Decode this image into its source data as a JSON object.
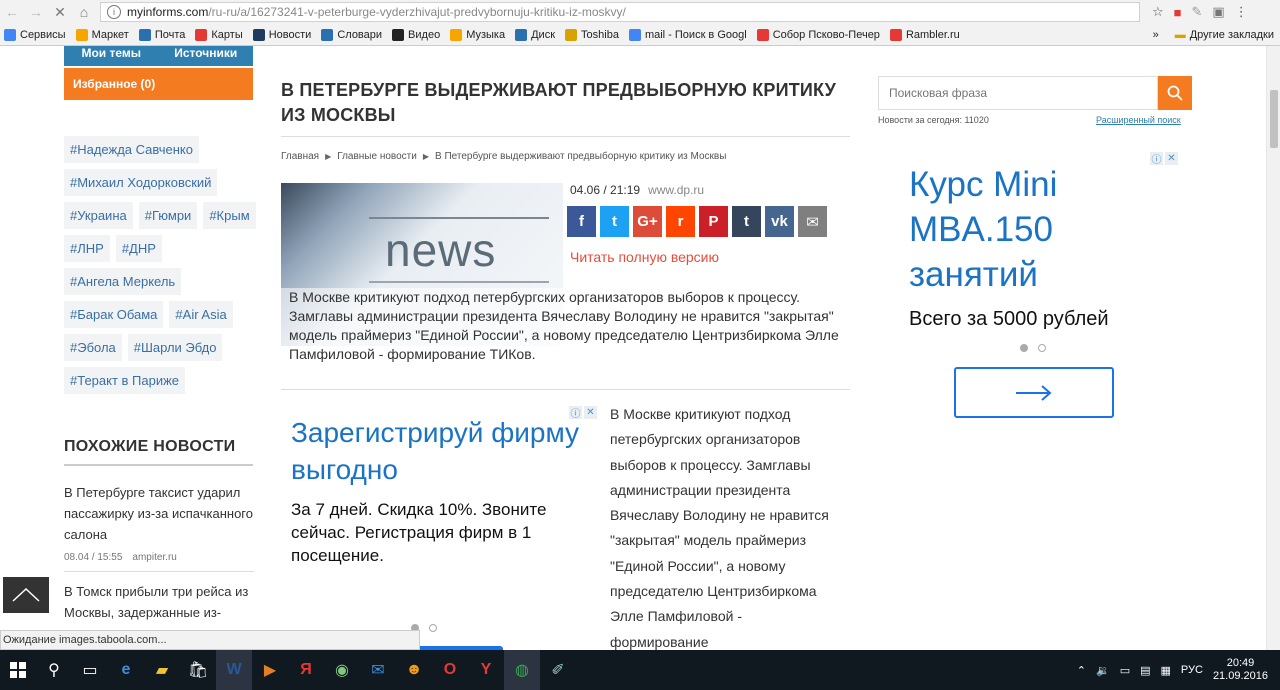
{
  "browser": {
    "url_host": "myinforms.com",
    "url_path": "/ru-ru/a/16273241-v-peterburge-vyderzhivajut-predvybornuju-kritiku-iz-moskvy/",
    "status": "Ожидание images.taboola.com..."
  },
  "bookmarks": [
    {
      "label": "Сервисы",
      "color": "#4285f4",
      "icon": "apps-icon"
    },
    {
      "label": "Маркет",
      "color": "#f7a600",
      "icon": "market-icon"
    },
    {
      "label": "Почта",
      "color": "#2a6fb0",
      "icon": "mail-icon"
    },
    {
      "label": "Карты",
      "color": "#e53935",
      "icon": "pin-icon"
    },
    {
      "label": "Новости",
      "color": "#1f3a5f",
      "icon": "news-icon"
    },
    {
      "label": "Словари",
      "color": "#2a6fb0",
      "icon": "dictionary-icon"
    },
    {
      "label": "Видео",
      "color": "#222222",
      "icon": "video-icon"
    },
    {
      "label": "Музыка",
      "color": "#f7a600",
      "icon": "music-icon"
    },
    {
      "label": "Диск",
      "color": "#2a6fb0",
      "icon": "disk-icon"
    },
    {
      "label": "Toshiba",
      "color": "#d8a200",
      "icon": "folder-icon"
    },
    {
      "label": "mail - Поиск в Googl",
      "color": "#4285f4",
      "icon": "google-icon"
    },
    {
      "label": "Собор Псково-Печер",
      "color": "#e53935",
      "icon": "yandex-icon"
    },
    {
      "label": "Rambler.ru",
      "color": "#e53935",
      "icon": "yandex-icon"
    }
  ],
  "bookmarks_other": "Другие закладки",
  "bookmarks_more": "»",
  "left": {
    "tab1": "Мои темы",
    "tab2": "Источники",
    "favorites": "Избранное (0)",
    "tags": [
      "#Надежда Савченко",
      "#Михаил Ходорковский",
      "#Украина",
      "#Гюмри",
      "#Крым",
      "#ЛНР",
      "#ДНР",
      "#Ангела Меркель",
      "#Барак Обама",
      "#Air Asia",
      "#Эбола",
      "#Шарли Эбдо",
      "#Теракт в Париже"
    ],
    "similar_title": "ПОХОЖИЕ НОВОСТИ",
    "similar": [
      {
        "text": "В Петербурге таксист ударил пассажирку из-за испачканного салона",
        "date": "08.04 / 15:55",
        "source": "ampiter.ru"
      },
      {
        "text": "В Томск прибыли три рейса из Москвы, задержанные из-",
        "date": "",
        "source": ""
      }
    ]
  },
  "article": {
    "title": "В ПЕТЕРБУРГЕ ВЫДЕРЖИВАЮТ ПРЕДВЫБОРНУЮ КРИТИКУ ИЗ МОСКВЫ",
    "breadcrumb": [
      "Главная",
      "Главные новости",
      "В Петербурге выдерживают предвыборную критику из Москвы"
    ],
    "image_word": "news",
    "date": "04.06 / 21:19",
    "source": "www.dp.ru",
    "share": [
      {
        "label": "f",
        "color": "#3b5998",
        "icon": "facebook-icon"
      },
      {
        "label": "t",
        "color": "#1da1f2",
        "icon": "twitter-icon"
      },
      {
        "label": "G+",
        "color": "#dd4b39",
        "icon": "google-plus-icon"
      },
      {
        "label": "r",
        "color": "#ff4500",
        "icon": "reddit-icon"
      },
      {
        "label": "P",
        "color": "#cb2027",
        "icon": "pinterest-icon"
      },
      {
        "label": "t",
        "color": "#35465c",
        "icon": "tumblr-icon"
      },
      {
        "label": "vk",
        "color": "#45668e",
        "icon": "vk-icon"
      },
      {
        "label": "✉",
        "color": "#7f7f7f",
        "icon": "email-icon"
      }
    ],
    "read_full": "Читать полную версию",
    "lead": "В Москве критикуют подход петербургских организаторов выборов к процессу. Замглавы администрации президента Вячеславу Володину  не нравится \"закрытая\" модель праймериз \"Единой России\", а новому председателю Центризбиркома Элле Памфиловой - формирование ТИКов.",
    "body": "В Москве критикуют подход петербургских организаторов выборов к процессу. Замглавы администрации президента Вячеславу Володину  не нравится \"закрытая\" модель праймериз \"Единой России\", а новому председателю Центризбиркома Элле Памфиловой - формирование"
  },
  "ad_center": {
    "headline": "Зарегистрируй фирму выгодно",
    "text": "За 7 дней. Скидка 10%. Звоните сейчас. Регистрация фирм в 1 посещение."
  },
  "ad_right": {
    "headline": "Курс Mini MBA.150 занятий",
    "text": "Всего за 5000 рублей"
  },
  "search": {
    "placeholder": "Поисковая фраза",
    "today": "Новости за сегодня: 11020",
    "advanced": "Расширенный поиск"
  },
  "taskbar": {
    "lang": "РУС",
    "time": "20:49",
    "date": "21.09.2016"
  }
}
